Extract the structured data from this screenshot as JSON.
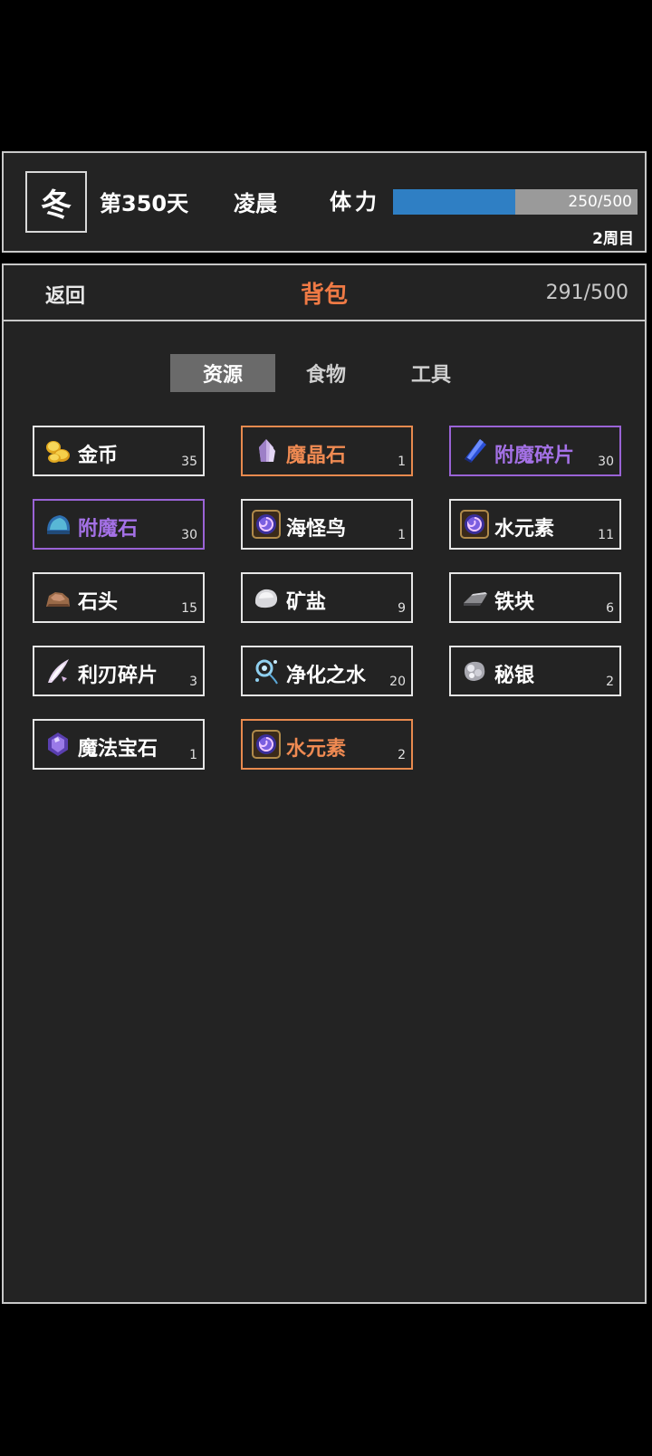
{
  "status": {
    "season": "冬",
    "day": "第350天",
    "time_of_day": "凌晨",
    "stamina_label": "体力",
    "stamina_text": "250/500",
    "stamina_fraction": 0.5,
    "round": "2周目"
  },
  "bag": {
    "back_label": "返回",
    "title": "背包",
    "capacity": "291/500",
    "tabs": [
      "资源",
      "食物",
      "工具"
    ],
    "active_tab": 0
  },
  "items": [
    {
      "name": "金币",
      "count": "35",
      "rarity": "common",
      "icon": "gold-coins-icon"
    },
    {
      "name": "魔晶石",
      "count": "1",
      "rarity": "orange",
      "icon": "magic-crystal-icon"
    },
    {
      "name": "附魔碎片",
      "count": "30",
      "rarity": "purple",
      "icon": "enchant-shard-icon"
    },
    {
      "name": "附魔石",
      "count": "30",
      "rarity": "purple",
      "icon": "enchant-stone-icon"
    },
    {
      "name": "海怪鸟",
      "count": "1",
      "rarity": "common",
      "icon": "vortex-orb-icon"
    },
    {
      "name": "水元素",
      "count": "11",
      "rarity": "common",
      "icon": "vortex-orb-icon"
    },
    {
      "name": "石头",
      "count": "15",
      "rarity": "common",
      "icon": "stone-icon"
    },
    {
      "name": "矿盐",
      "count": "9",
      "rarity": "common",
      "icon": "rock-salt-icon"
    },
    {
      "name": "铁块",
      "count": "6",
      "rarity": "common",
      "icon": "iron-ingot-icon"
    },
    {
      "name": "利刃碎片",
      "count": "3",
      "rarity": "common",
      "icon": "blade-shard-icon"
    },
    {
      "name": "净化之水",
      "count": "20",
      "rarity": "common",
      "icon": "purified-water-icon"
    },
    {
      "name": "秘银",
      "count": "2",
      "rarity": "common",
      "icon": "mithril-icon"
    },
    {
      "name": "魔法宝石",
      "count": "1",
      "rarity": "common",
      "icon": "magic-gem-icon"
    },
    {
      "name": "水元素",
      "count": "2",
      "rarity": "orange",
      "icon": "vortex-orb-icon"
    }
  ]
}
